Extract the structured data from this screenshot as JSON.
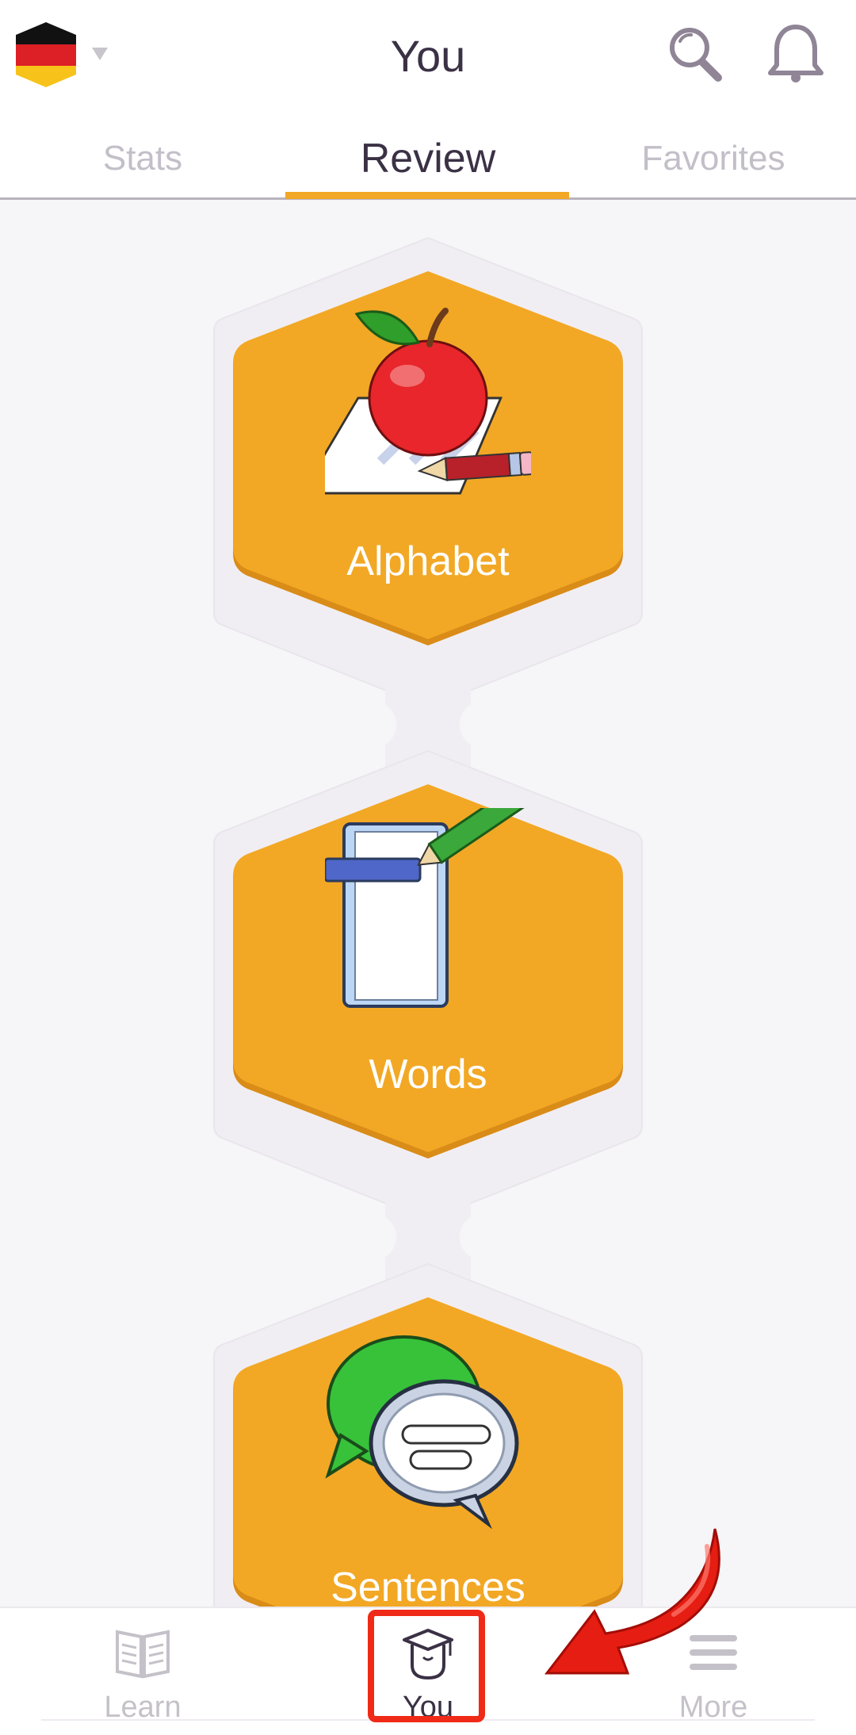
{
  "header": {
    "title": "You",
    "language_flag_icon": "germany-flag-icon",
    "dropdown_icon": "caret-down-icon",
    "search_icon": "search-icon",
    "notification_icon": "bell-icon"
  },
  "tabs": [
    {
      "label": "Stats",
      "active": false
    },
    {
      "label": "Review",
      "active": true
    },
    {
      "label": "Favorites",
      "active": false
    }
  ],
  "review_nodes": [
    {
      "label": "Alphabet",
      "icon": "apple-paper-pencil-icon"
    },
    {
      "label": "Words",
      "icon": "notebook-pencil-icon"
    },
    {
      "label": "Sentences",
      "icon": "speech-bubbles-icon"
    }
  ],
  "bottom_nav": [
    {
      "label": "Learn",
      "icon": "book-icon",
      "active": false
    },
    {
      "label": "You",
      "icon": "graduation-cap-icon",
      "active": true
    },
    {
      "label": "More",
      "icon": "menu-icon",
      "active": false
    }
  ],
  "colors": {
    "accent": "#f2a825",
    "title_text": "#3b3145",
    "inactive_text": "#c3bfc8",
    "highlight": "#ef2a17",
    "background": "#f6f5f7"
  }
}
